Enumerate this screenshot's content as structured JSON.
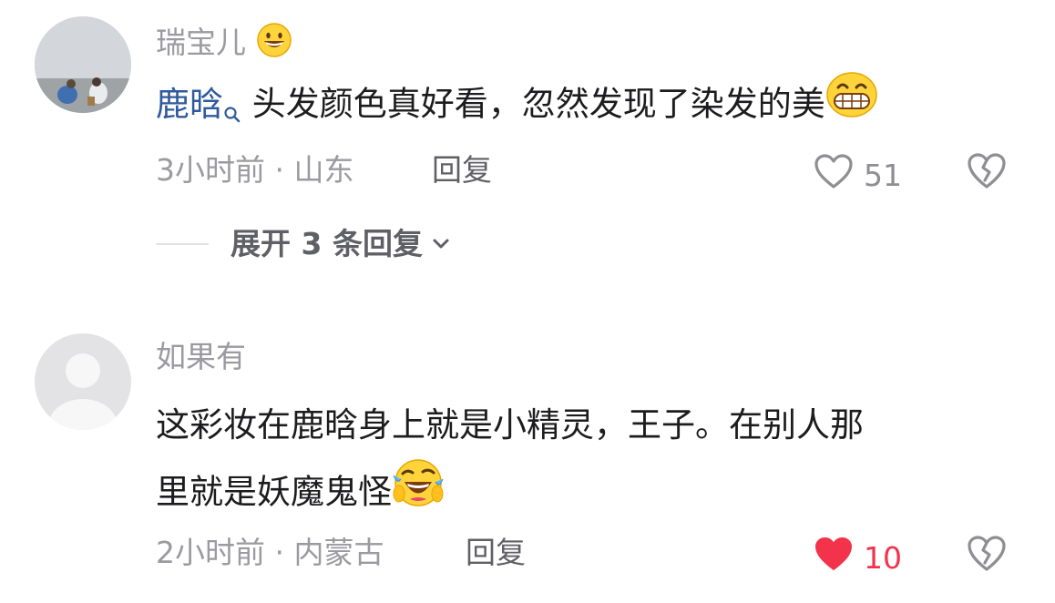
{
  "comments": [
    {
      "username": "瑞宝儿",
      "mention": "鹿晗",
      "text_line1": "头发颜色真好看，忽然发现了染发的美",
      "time": "3小时前",
      "location": "山东",
      "reply_label": "回复",
      "likes": "51",
      "liked": false,
      "expand_label": "展开 3 条回复"
    },
    {
      "username": "如果有",
      "text_line1": "这彩妆在鹿晗身上就是小精灵，王子。在别人那",
      "text_line2": "里就是妖魔鬼怪",
      "time": "2小时前",
      "location": "内蒙古",
      "reply_label": "回复",
      "likes": "10",
      "liked": true
    }
  ],
  "separator": " · ",
  "colors": {
    "like_active": "#f2334b",
    "mention": "#2f5a9e",
    "muted": "#9a9aa0"
  }
}
